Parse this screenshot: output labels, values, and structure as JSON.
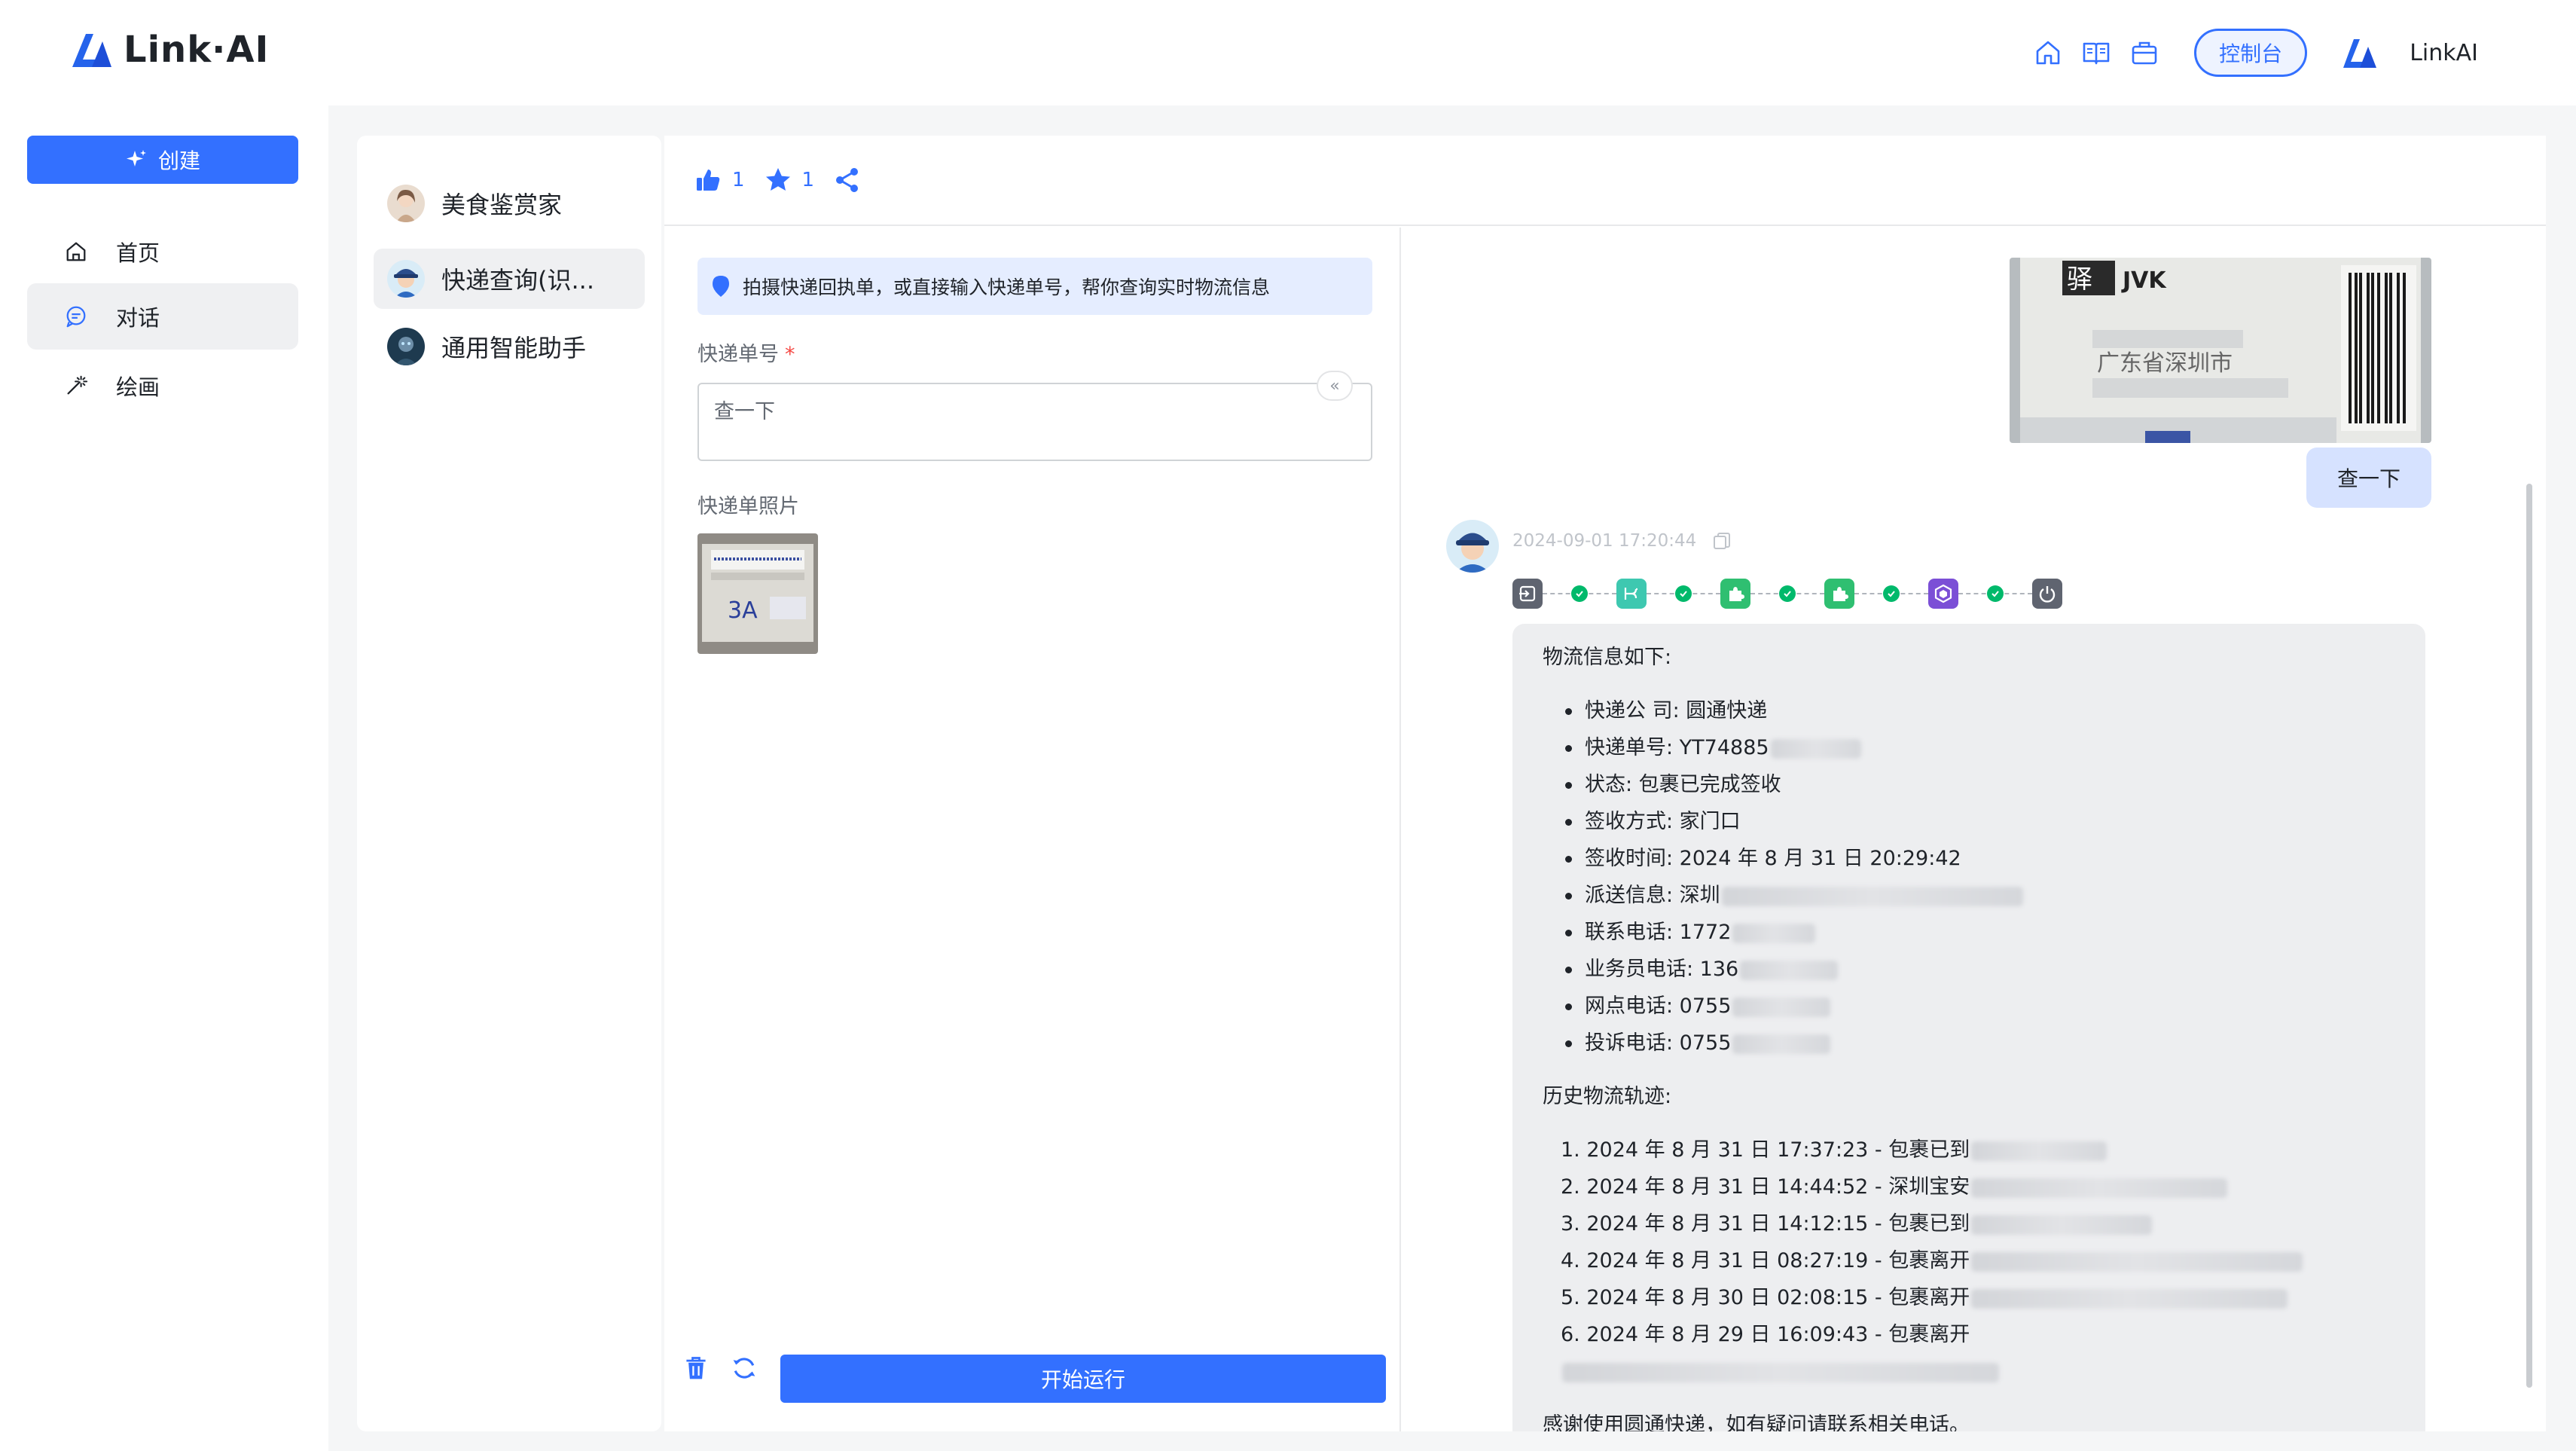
{
  "header": {
    "logo_text": "Link·AI",
    "console_label": "控制台",
    "brand_name": "LinkAI"
  },
  "nav": {
    "create_label": "创建",
    "items": [
      {
        "label": "首页",
        "icon": "home-icon"
      },
      {
        "label": "对话",
        "icon": "chat-icon",
        "active": true
      },
      {
        "label": "绘画",
        "icon": "paint-icon"
      }
    ]
  },
  "apps": [
    {
      "name": "美食鉴赏家"
    },
    {
      "name": "快递查询(识...",
      "active": true
    },
    {
      "name": "通用智能助手"
    }
  ],
  "toolbar": {
    "like_count": "1",
    "star_count": "1"
  },
  "form": {
    "tip": "拍摄快递回执单，或直接输入快递单号，帮你查询实时物流信息",
    "tracking_label": "快递单号",
    "required_mark": "*",
    "tracking_value": "查一下",
    "photo_label": "快递单照片",
    "thumb_text": "3A",
    "run_label": "开始运行"
  },
  "chat": {
    "user_image_text": "JVK",
    "user_image_text2": "广东省深圳市",
    "user_message": "查一下",
    "timestamp": "2024-09-01 17:20:44",
    "answer": {
      "intro": "物流信息如下:",
      "fields": [
        {
          "text": "快递公 司: 圆通快递",
          "blur": 0
        },
        {
          "text": "快递单号: YT74885",
          "blur": 120
        },
        {
          "text": "状态: 包裹已完成签收",
          "blur": 0
        },
        {
          "text": "签收方式: 家门口",
          "blur": 0
        },
        {
          "text": "签收时间: 2024 年 8 月 31 日 20:29:42",
          "blur": 0
        },
        {
          "text": "派送信息: 深圳",
          "blur": 400
        },
        {
          "text": "联系电话: 1772",
          "blur": 110
        },
        {
          "text": "业务员电话: 136",
          "blur": 130
        },
        {
          "text": "网点电话: 0755",
          "blur": 130
        },
        {
          "text": "投诉电话: 0755",
          "blur": 130
        }
      ],
      "history_title": "历史物流轨迹:",
      "history": [
        {
          "text": "1. 2024 年 8 月 31 日 17:37:23 - 包裹已到",
          "blur": 180
        },
        {
          "text": "2. 2024 年 8 月 31 日 14:44:52 - 深圳宝安",
          "blur": 340
        },
        {
          "text": "3. 2024 年 8 月 31 日 14:12:15 - 包裹已到",
          "blur": 240
        },
        {
          "text": "4. 2024 年 8 月 31 日 08:27:19 - 包裹离开",
          "blur": 440
        },
        {
          "text": "5. 2024 年 8 月 30 日 02:08:15 - 包裹离开",
          "blur": 420
        },
        {
          "text": "6. 2024 年 8 月 29 日 16:09:43 - 包裹离开",
          "blur": 580
        }
      ],
      "closing": "感谢使用圆通快递，如有疑问请联系相关电话。"
    }
  },
  "colors": {
    "accent": "#3370ff",
    "success": "#00b96b",
    "workflow_teal": "#3ec8b0",
    "workflow_green": "#2fbf71",
    "workflow_purple": "#7b4fd6"
  }
}
